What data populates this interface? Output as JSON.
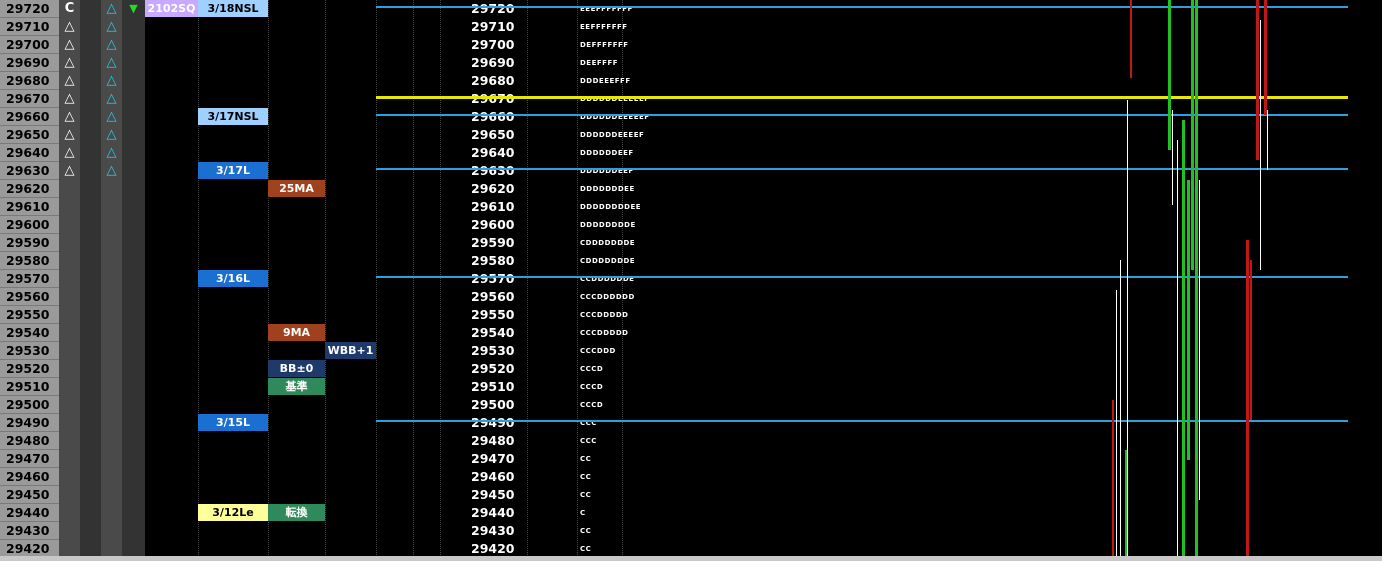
{
  "ladder": [
    {
      "price": "29720",
      "c1": "C",
      "c2": "",
      "c3": "tri-c",
      "c4": "tri-down",
      "tpo": "EEEFFFFFFF"
    },
    {
      "price": "29710",
      "c1": "tri-w",
      "c2": "",
      "c3": "tri-c",
      "c4": "",
      "tpo": "EEFFFFFFF"
    },
    {
      "price": "29700",
      "c1": "tri-w",
      "c2": "",
      "c3": "tri-c",
      "c4": "",
      "tpo": "DEFFFFFFF"
    },
    {
      "price": "29690",
      "c1": "tri-w",
      "c2": "",
      "c3": "tri-c",
      "c4": "",
      "tpo": "DEEFFFF"
    },
    {
      "price": "29680",
      "c1": "tri-w",
      "c2": "",
      "c3": "tri-c",
      "c4": "",
      "tpo": "DDDEEEFFF"
    },
    {
      "price": "29670",
      "c1": "tri-w",
      "c2": "",
      "c3": "tri-c",
      "c4": "",
      "tpo": "DDDDDDEEEEEF"
    },
    {
      "price": "29660",
      "c1": "tri-w",
      "c2": "",
      "c3": "tri-c",
      "c4": "",
      "tpo": "DDDDDDEEEEEF"
    },
    {
      "price": "29650",
      "c1": "tri-w",
      "c2": "",
      "c3": "tri-c",
      "c4": "",
      "tpo": "DDDDDDEEEEF"
    },
    {
      "price": "29640",
      "c1": "tri-w",
      "c2": "",
      "c3": "tri-c",
      "c4": "",
      "tpo": "DDDDDDEEF"
    },
    {
      "price": "29630",
      "c1": "tri-w",
      "c2": "",
      "c3": "tri-c",
      "c4": "",
      "tpo": "DDDDDDEEF"
    },
    {
      "price": "29620",
      "c1": "",
      "c2": "",
      "c3": "",
      "c4": "",
      "tpo": "DDDDDDDEE"
    },
    {
      "price": "29610",
      "c1": "",
      "c2": "",
      "c3": "",
      "c4": "",
      "tpo": "DDDDDDDDEE"
    },
    {
      "price": "29600",
      "c1": "",
      "c2": "",
      "c3": "",
      "c4": "",
      "tpo": "DDDDDDDDE"
    },
    {
      "price": "29590",
      "c1": "",
      "c2": "",
      "c3": "",
      "c4": "",
      "tpo": "CDDDDDDDE"
    },
    {
      "price": "29580",
      "c1": "",
      "c2": "",
      "c3": "",
      "c4": "",
      "tpo": "CDDDDDDDE"
    },
    {
      "price": "29570",
      "c1": "",
      "c2": "",
      "c3": "",
      "c4": "",
      "tpo": "CCDDDDDDE"
    },
    {
      "price": "29560",
      "c1": "",
      "c2": "",
      "c3": "",
      "c4": "",
      "tpo": "CCCDDDDDD"
    },
    {
      "price": "29550",
      "c1": "",
      "c2": "",
      "c3": "",
      "c4": "",
      "tpo": "CCCDDDDD"
    },
    {
      "price": "29540",
      "c1": "",
      "c2": "",
      "c3": "",
      "c4": "",
      "tpo": "CCCDDDDD"
    },
    {
      "price": "29530",
      "c1": "",
      "c2": "",
      "c3": "",
      "c4": "",
      "tpo": "CCCDDD"
    },
    {
      "price": "29520",
      "c1": "",
      "c2": "",
      "c3": "",
      "c4": "",
      "tpo": "CCCD"
    },
    {
      "price": "29510",
      "c1": "",
      "c2": "",
      "c3": "",
      "c4": "",
      "tpo": "CCCD"
    },
    {
      "price": "29500",
      "c1": "",
      "c2": "",
      "c3": "",
      "c4": "",
      "tpo": "CCCD"
    },
    {
      "price": "29490",
      "c1": "",
      "c2": "",
      "c3": "",
      "c4": "",
      "tpo": "CCC"
    },
    {
      "price": "29480",
      "c1": "",
      "c2": "",
      "c3": "",
      "c4": "",
      "tpo": "CCC"
    },
    {
      "price": "29470",
      "c1": "",
      "c2": "",
      "c3": "",
      "c4": "",
      "tpo": "CC"
    },
    {
      "price": "29460",
      "c1": "",
      "c2": "",
      "c3": "",
      "c4": "",
      "tpo": "CC"
    },
    {
      "price": "29450",
      "c1": "",
      "c2": "",
      "c3": "",
      "c4": "",
      "tpo": "CC"
    },
    {
      "price": "29440",
      "c1": "",
      "c2": "",
      "c3": "",
      "c4": "",
      "tpo": "C"
    },
    {
      "price": "29430",
      "c1": "",
      "c2": "",
      "c3": "",
      "c4": "",
      "tpo": "CC"
    },
    {
      "price": "29420",
      "c1": "",
      "c2": "",
      "c3": "",
      "c4": "",
      "tpo": "CC"
    }
  ],
  "labels": [
    {
      "row": 0,
      "col": "a",
      "text": "2102SQ",
      "bg": "#c9a8ff",
      "fg": "#ffffff"
    },
    {
      "row": 0,
      "col": "b",
      "text": "3/18NSL",
      "bg": "#9fd0ff",
      "fg": "#000000"
    },
    {
      "row": 6,
      "col": "b",
      "text": "3/17NSL",
      "bg": "#9fd0ff",
      "fg": "#000000"
    },
    {
      "row": 9,
      "col": "b",
      "text": "3/17L",
      "bg": "#1a6fd0",
      "fg": "#ffffff"
    },
    {
      "row": 10,
      "col": "c",
      "text": "25MA",
      "bg": "#a0411e",
      "fg": "#ffffff"
    },
    {
      "row": 15,
      "col": "b",
      "text": "3/16L",
      "bg": "#1a6fd0",
      "fg": "#ffffff"
    },
    {
      "row": 18,
      "col": "c",
      "text": "9MA",
      "bg": "#a0411e",
      "fg": "#ffffff"
    },
    {
      "row": 19,
      "col": "d",
      "text": "WBB+1",
      "bg": "#1e3a6a",
      "fg": "#ffffff"
    },
    {
      "row": 20,
      "col": "c",
      "text": "BB±0",
      "bg": "#1e3a6a",
      "fg": "#ffffff"
    },
    {
      "row": 21,
      "col": "c",
      "text": "基準",
      "bg": "#2e8a5a",
      "fg": "#ffffff"
    },
    {
      "row": 23,
      "col": "b",
      "text": "3/15L",
      "bg": "#1a6fd0",
      "fg": "#ffffff"
    },
    {
      "row": 28,
      "col": "b",
      "text": "3/12Le",
      "bg": "#ffff99",
      "fg": "#000000"
    },
    {
      "row": 28,
      "col": "c",
      "text": "転換",
      "bg": "#2e8a5a",
      "fg": "#ffffff"
    }
  ],
  "hlines": [
    {
      "row": 0,
      "color": "#2aa0e0"
    },
    {
      "row": 5,
      "color": "#e8e800"
    },
    {
      "row": 6,
      "color": "#2aa0e0"
    },
    {
      "row": 9,
      "color": "#2aa0e0"
    },
    {
      "row": 15,
      "color": "#2aa0e0"
    },
    {
      "row": 23,
      "color": "#2aa0e0"
    }
  ],
  "colors": {
    "up": "#22c022",
    "down": "#c01818",
    "wick": "#ffffff"
  }
}
